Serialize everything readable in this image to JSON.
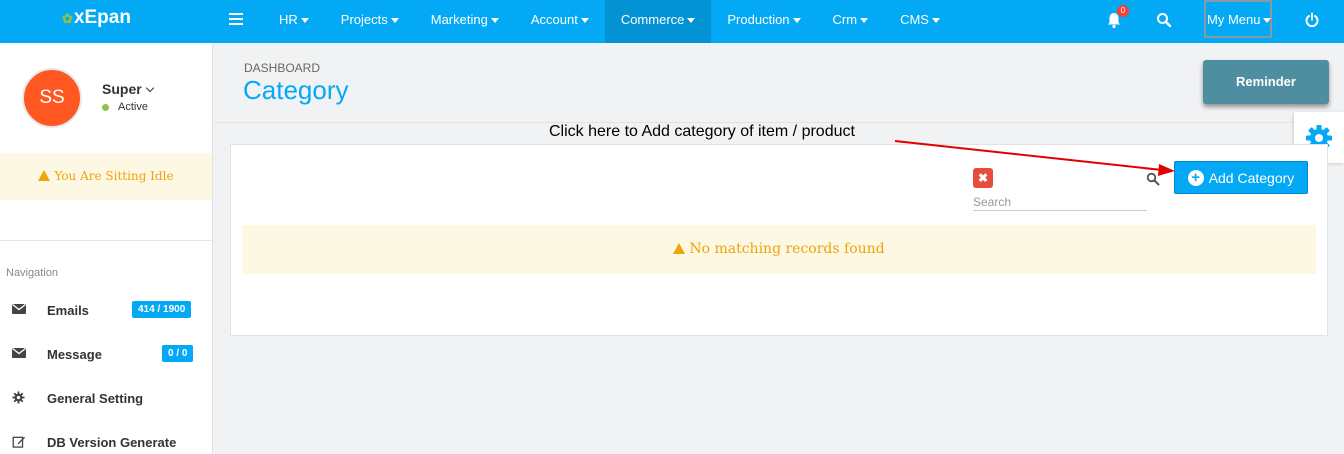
{
  "app": {
    "logo_text": "xEpan"
  },
  "topbar": {
    "menu": [
      {
        "label": "HR",
        "active": false
      },
      {
        "label": "Projects",
        "active": false
      },
      {
        "label": "Marketing",
        "active": false
      },
      {
        "label": "Account",
        "active": false
      },
      {
        "label": "Commerce",
        "active": true
      },
      {
        "label": "Production",
        "active": false
      },
      {
        "label": "Crm",
        "active": false
      },
      {
        "label": "CMS",
        "active": false
      }
    ],
    "notification_count": "0",
    "my_menu_label": "My Menu",
    "accent_color": "#03a9f4"
  },
  "user": {
    "initials": "SS",
    "name": "Super",
    "status": "Active",
    "avatar_color": "#ff5722"
  },
  "sidebar": {
    "idle_message": "You Are Sitting Idle",
    "nav_heading": "Navigation",
    "items": [
      {
        "label": "Emails",
        "badge": "414 / 1900",
        "icon": "envelope-icon"
      },
      {
        "label": "Message",
        "badge": "0 / 0",
        "icon": "envelope-icon"
      },
      {
        "label": "General Setting",
        "badge": "",
        "icon": "gear-icon"
      },
      {
        "label": "DB Version Generate",
        "badge": "",
        "icon": "edit-icon"
      }
    ]
  },
  "header": {
    "breadcrumb": "DASHBOARD",
    "title": "Category",
    "reminder_label": "Reminder"
  },
  "grid": {
    "search_placeholder": "Search",
    "search_value": "",
    "clear_label": "✖",
    "add_button_label": "Add Category",
    "empty_message": "No matching records found"
  },
  "annotation": {
    "text": "Click here to Add category of item / product",
    "color": "#e00000"
  }
}
